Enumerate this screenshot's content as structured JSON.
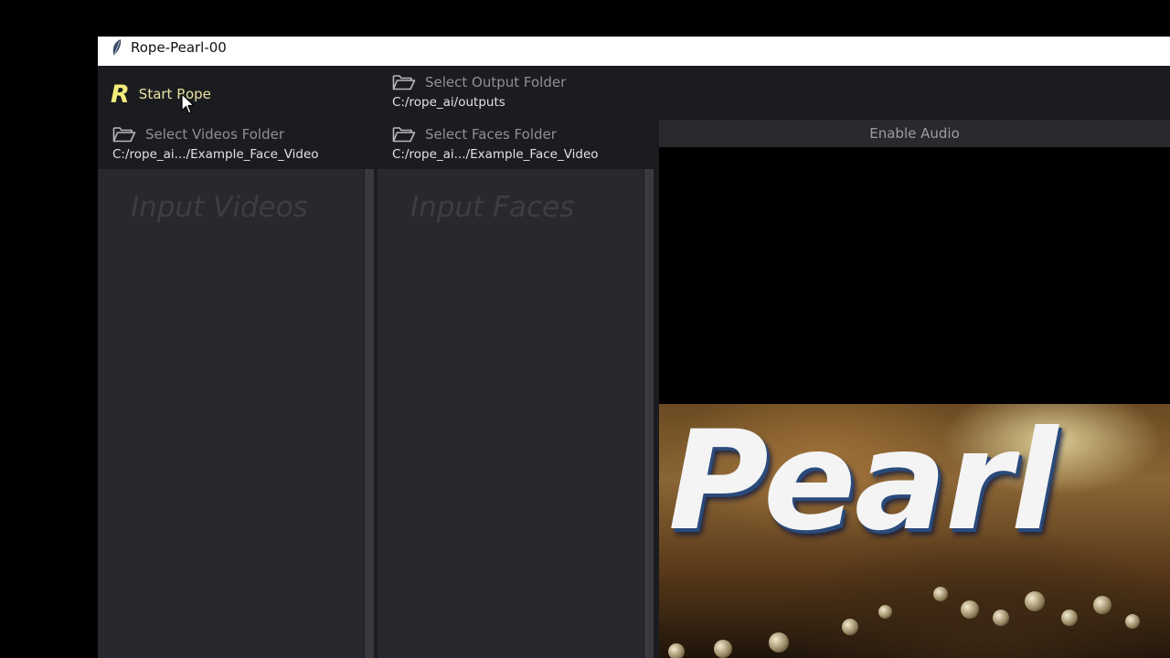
{
  "window": {
    "title": "Rope-Pearl-00",
    "icon": "feather-icon"
  },
  "toolbar": {
    "start_label": "Start Rope",
    "logo_letter": "R",
    "output": {
      "label": "Select Output Folder",
      "path": "C:/rope_ai/outputs"
    }
  },
  "videos": {
    "folder_label": "Select Videos Folder",
    "path": "C:/rope_ai.../Example_Face_Video",
    "panel_title": "Input Videos"
  },
  "faces": {
    "folder_label": "Select Faces Folder",
    "path": "C:/rope_ai.../Example_Face_Video",
    "panel_title": "Input Faces"
  },
  "preview": {
    "audio_label": "Enable Audio",
    "image_text": "Pearl"
  },
  "colors": {
    "accent_yellow": "#f3ec7a",
    "background": "#1b1c1f",
    "panel": "#28292e"
  }
}
